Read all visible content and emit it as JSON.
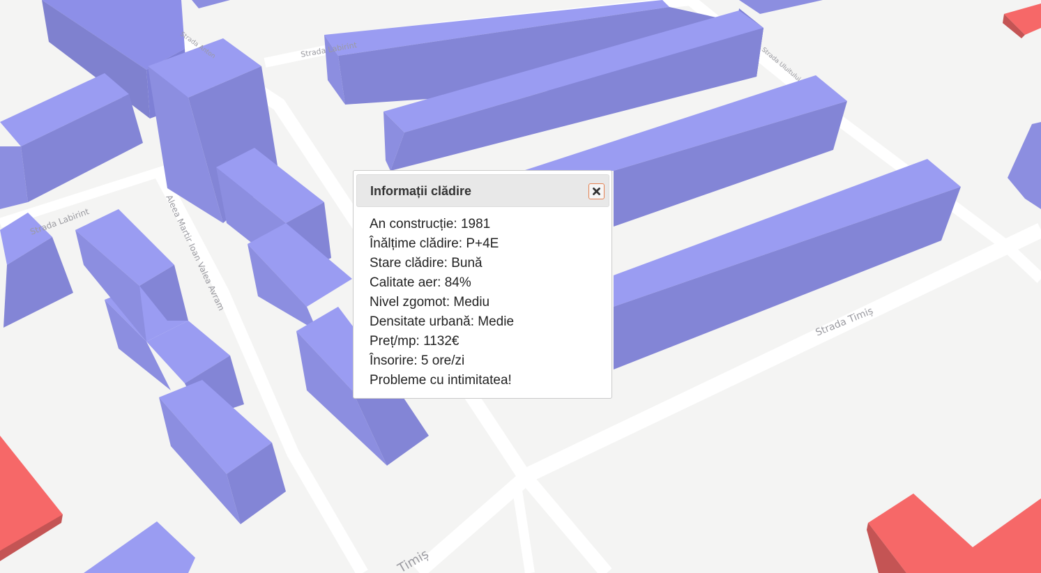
{
  "map": {
    "street_labels": [
      "Strada Labirint",
      "Strada Labirint",
      "Aleea Martir Ioan Valea Avram",
      "Strada Timiș",
      "Timiș",
      "Strada Anton",
      "Strada Uluitului"
    ],
    "colors": {
      "background": "#f4f4f3",
      "road": "#ffffff",
      "building_default": "#9a9cf2",
      "building_highlight": "#f66868"
    }
  },
  "popup": {
    "title": "Informații clădire",
    "close_icon": "close-icon",
    "lines": [
      "An construcție: 1981",
      "Înălțime clădire: P+4E",
      "Stare clădire: Bună",
      "Calitate aer: 84%",
      "Nivel zgomot: Mediu",
      "Densitate urbană: Medie",
      "Preț/mp: 1132€",
      "Însorire: 5 ore/zi",
      "Probleme cu intimitatea!"
    ]
  }
}
